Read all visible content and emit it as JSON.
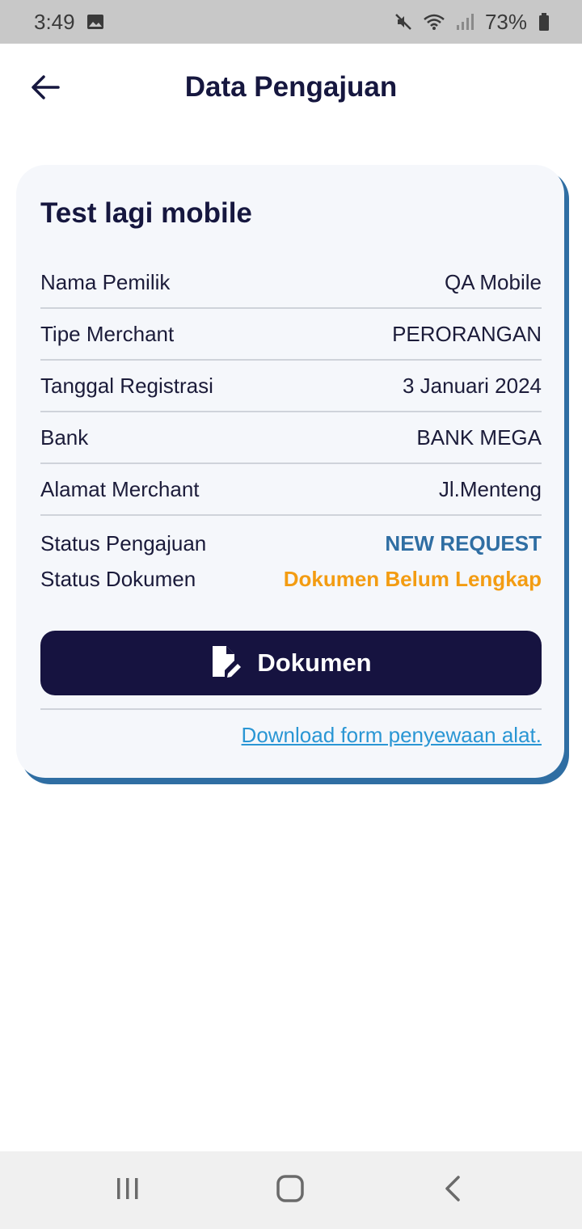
{
  "status_bar": {
    "time": "3:49",
    "battery": "73%"
  },
  "header": {
    "title": "Data Pengajuan"
  },
  "card": {
    "title": "Test lagi mobile",
    "rows": [
      {
        "label": "Nama Pemilik",
        "value": "QA Mobile"
      },
      {
        "label": "Tipe Merchant",
        "value": "PERORANGAN"
      },
      {
        "label": "Tanggal Registrasi",
        "value": "3 Januari 2024"
      },
      {
        "label": "Bank",
        "value": "BANK MEGA"
      },
      {
        "label": "Alamat Merchant",
        "value": "Jl.Menteng"
      }
    ],
    "status_pengajuan": {
      "label": "Status Pengajuan",
      "value": "NEW REQUEST"
    },
    "status_dokumen": {
      "label": "Status Dokumen",
      "value": "Dokumen Belum Lengkap"
    },
    "document_button_label": "Dokumen",
    "download_link": "Download form penyewaan alat."
  },
  "colors": {
    "primary": "#161340",
    "accent_blue": "#2f6ea3",
    "status_orange": "#f39c12",
    "link": "#2a96d4"
  },
  "icons": {
    "back": "arrow-left-icon",
    "document": "document-edit-icon",
    "nav_recent": "recent-apps-icon",
    "nav_home": "home-icon",
    "nav_back": "nav-back-icon"
  }
}
